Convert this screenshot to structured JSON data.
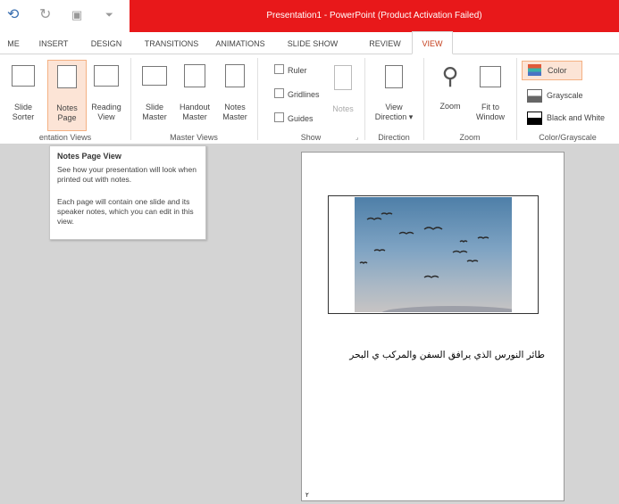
{
  "window": {
    "title": "Presentation1 - PowerPoint (Product Activation Failed)"
  },
  "tabs": [
    {
      "label": "ME"
    },
    {
      "label": "INSERT"
    },
    {
      "label": "DESIGN"
    },
    {
      "label": "TRANSITIONS"
    },
    {
      "label": "ANIMATIONS"
    },
    {
      "label": "SLIDE SHOW"
    },
    {
      "label": "REVIEW"
    },
    {
      "label": "VIEW"
    }
  ],
  "ribbon": {
    "presentation_views": {
      "label": "entation Views",
      "slide_sorter": "Slide\nSorter",
      "notes_page": "Notes\nPage",
      "reading_view": "Reading\nView"
    },
    "master_views": {
      "label": "Master Views",
      "slide_master": "Slide\nMaster",
      "handout_master": "Handout\nMaster",
      "notes_master": "Notes\nMaster"
    },
    "show": {
      "label": "Show",
      "ruler": "Ruler",
      "gridlines": "Gridlines",
      "guides": "Guides",
      "notes": "Notes"
    },
    "direction": {
      "label": "Direction",
      "view_direction": "View\nDirection ▾"
    },
    "zoom": {
      "label": "Zoom",
      "zoom": "Zoom",
      "fit_to_window": "Fit to\nWindow"
    },
    "color_grayscale": {
      "label": "Color/Grayscale",
      "color": "Color",
      "grayscale": "Grayscale",
      "black_and_white": "Black and White"
    }
  },
  "tooltip": {
    "title": "Notes Page View",
    "p1": "See how your presentation will look when printed out with notes.",
    "p2": "Each page will contain one slide and its speaker notes, which you can edit in this view."
  },
  "notes_page": {
    "notes_text": "طائر النورس الذي يرافق السفن والمركب ي البحر",
    "page_number": "٢"
  },
  "colors": {
    "accent": "#e8181a",
    "active_tab": "#c43e1c",
    "selected": "#fce4d6"
  }
}
